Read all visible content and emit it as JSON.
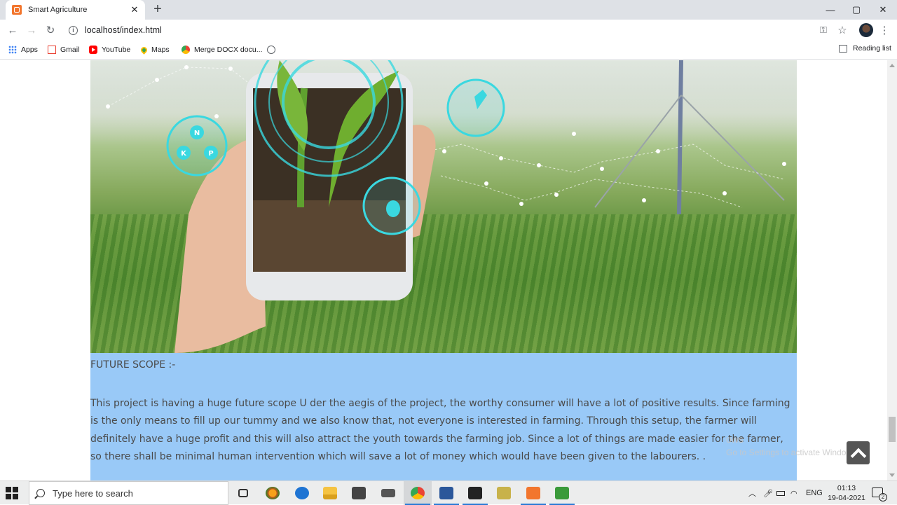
{
  "browser": {
    "tab_title": "Smart Agriculture",
    "url": "localhost/index.html",
    "bookmarks": [
      {
        "label": "Apps",
        "icon": "apps-grid-icon"
      },
      {
        "label": "Gmail",
        "icon": "gmail-icon"
      },
      {
        "label": "YouTube",
        "icon": "youtube-icon"
      },
      {
        "label": "Maps",
        "icon": "maps-pin-icon"
      },
      {
        "label": "Merge DOCX docu...",
        "icon": "merge-icon"
      }
    ],
    "reading_list": "Reading list"
  },
  "page": {
    "hero_alt": "hand-holding-phone-with-plant",
    "hero_badges": {
      "n": "N",
      "k": "K",
      "p": "P"
    },
    "section_title": "FUTURE SCOPE :-",
    "section_text": "This project is having a huge future scope U der the aegis of the project, the worthy consumer will have a lot of positive results. Since farming is the only means to fill up our tummy and we also know that, not everyone is interested in farming. Through this setup, the farmer will definitely have a huge profit and this will also attract the youth towards the farming job. Since a lot of things are made easier for the farmer, so there shall be minimal human intervention which will save a lot of money which would have been given to the labourers. .",
    "section_bg": "#99c9f7"
  },
  "overlay": {
    "watermark_line1": "ows",
    "watermark_line2": "Go to Settings to activate Windo"
  },
  "taskbar": {
    "search_placeholder": "Type here to search",
    "language": "ENG",
    "time": "01:13",
    "date": "19-04-2021",
    "notification_count": "2"
  }
}
